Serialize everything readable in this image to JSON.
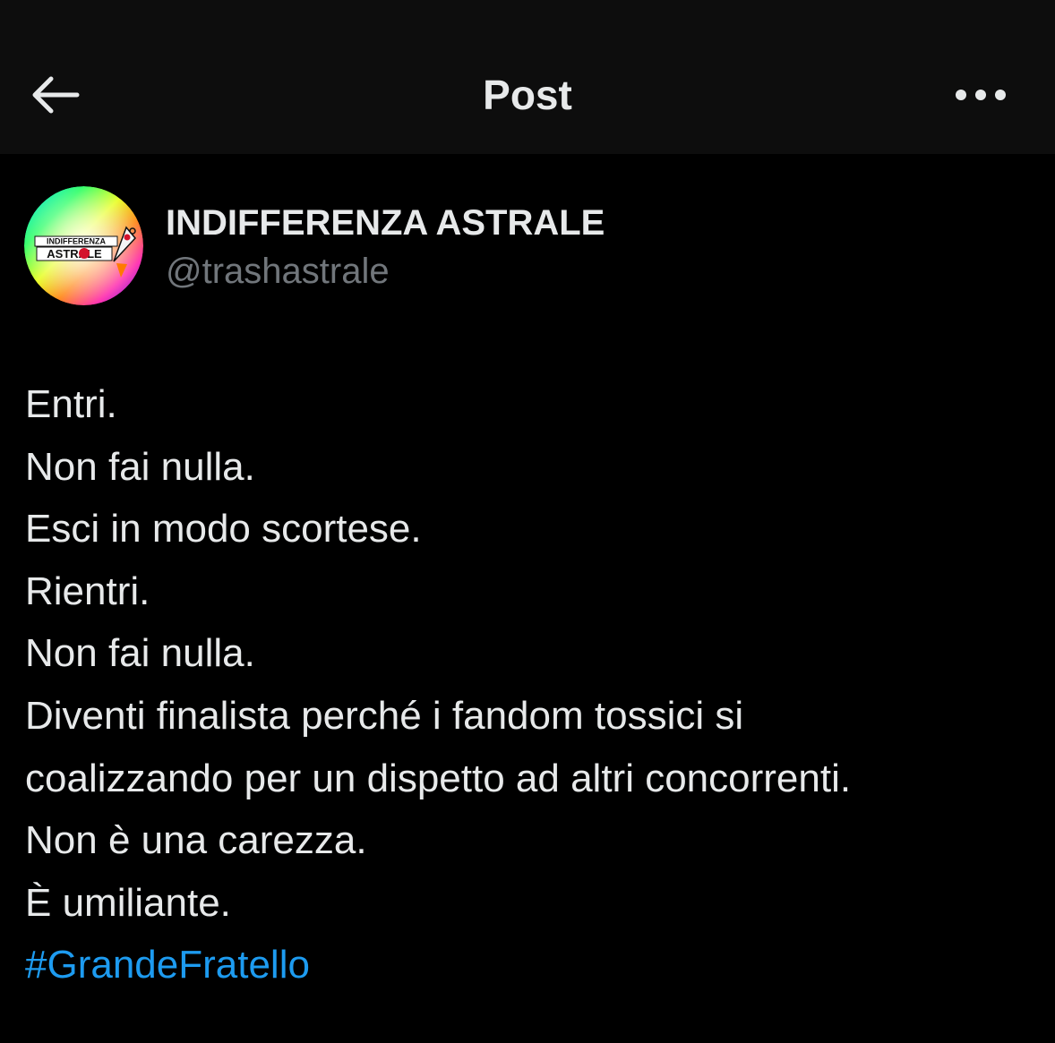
{
  "colors": {
    "background": "#000000",
    "header_background": "#0d0d0d",
    "text_primary": "#e7e9ea",
    "text_secondary": "#71767b",
    "link": "#1d9bf0"
  },
  "header": {
    "back_icon": "arrow-left-icon",
    "title": "Post",
    "more_icon": "more-horizontal-icon"
  },
  "author": {
    "avatar_text_top": "INDIFFERENZA",
    "avatar_text_bottom": "ASTRALE",
    "display_name": "INDIFFERENZA ASTRALE",
    "handle": "@trashastrale"
  },
  "post": {
    "lines": [
      "Entri.",
      "Non fai nulla.",
      "Esci in modo scortese.",
      "Rientri.",
      "Non fai nulla.",
      "Diventi finalista perché i fandom tossici si",
      "coalizzando per un dispetto ad altri concorrenti.",
      "Non è una carezza.",
      "È umiliante."
    ],
    "hashtag": "#GrandeFratello"
  }
}
